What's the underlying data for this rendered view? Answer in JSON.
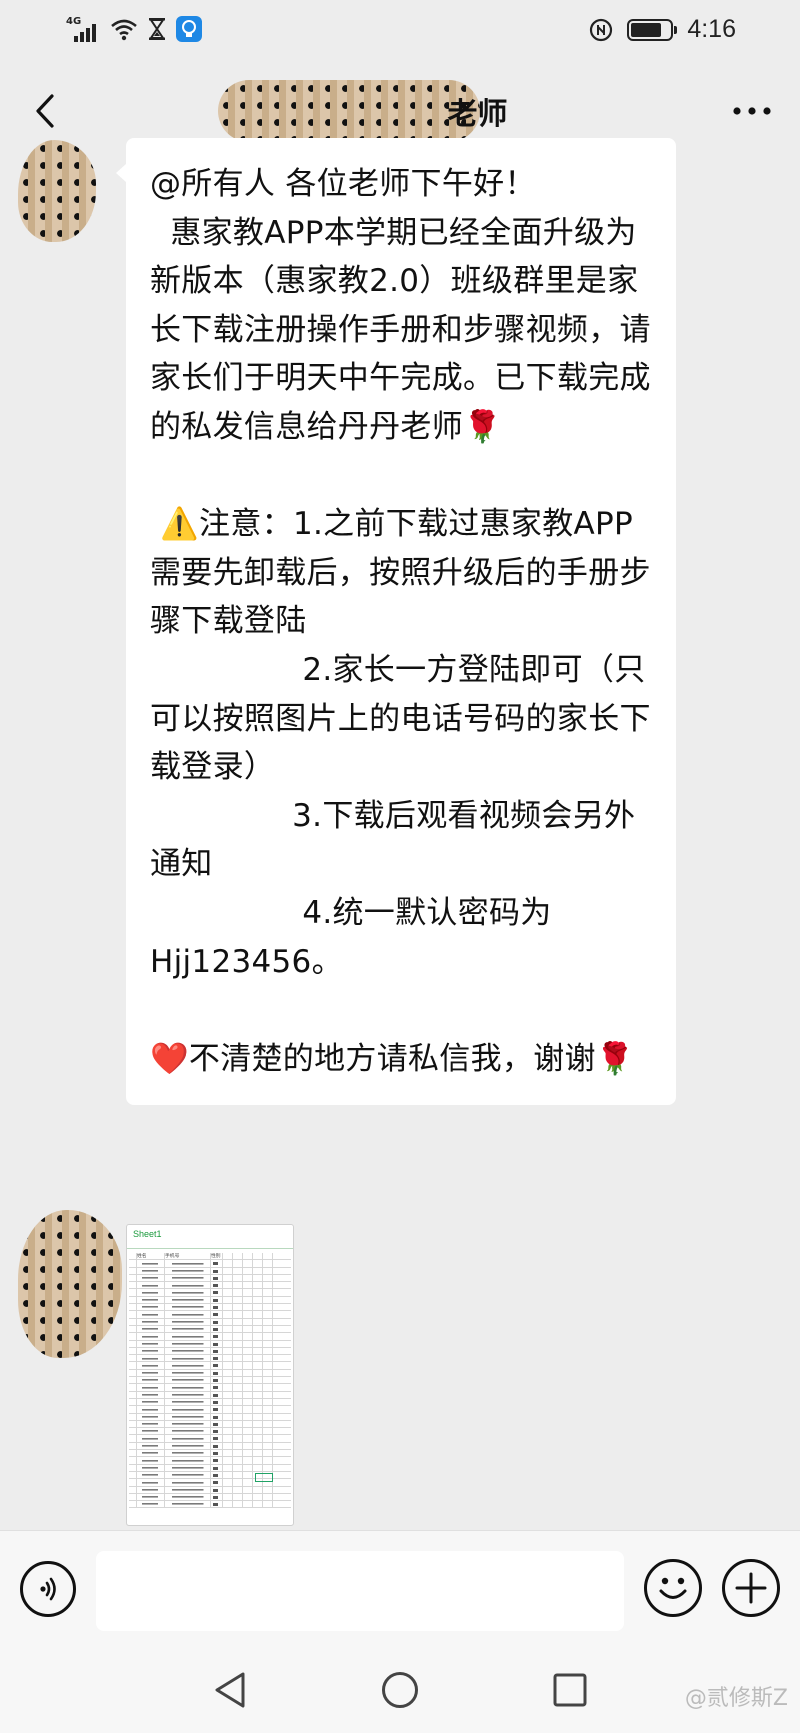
{
  "status_bar": {
    "network": "4G",
    "time": "4:16",
    "icons": [
      "signal-icon",
      "wifi-icon",
      "hourglass-icon",
      "notification-app-icon",
      "nfc-icon",
      "battery-icon"
    ]
  },
  "header": {
    "title": "老师",
    "back_icon": "chevron-left-icon",
    "more_icon": "more-dots-icon"
  },
  "messages": [
    {
      "type": "text",
      "text": "@所有人 各位老师下午好！\n  惠家教APP本学期已经全面升级为新版本（惠家教2.0）班级群里是家长下载注册操作手册和步骤视频，请家长们于明天中午完成。已下载完成的私发信息给丹丹老师🌹\n\n ⚠️注意：1.之前下载过惠家教APP需要先卸载后，按照升级后的手册步骤下载登陆\n               2.家长一方登陆即可（只可以按照图片上的电话号码的家长下载登录）\n              3.下载后观看视频会另外通知\n               4.统一默认密码为Hjj123456。\n\n❤️不清楚的地方请私信我，谢谢🌹"
    },
    {
      "type": "image",
      "sheet_tab": "Sheet1",
      "headers": [
        "",
        "姓名",
        "手机号",
        "性别"
      ]
    }
  ],
  "input_bar": {
    "placeholder": "",
    "voice_icon": "voice-icon",
    "emoji_icon": "emoji-icon",
    "plus_icon": "plus-icon"
  },
  "system_nav": {
    "back_icon": "triangle-back-icon",
    "home_icon": "circle-home-icon",
    "recents_icon": "square-recents-icon"
  },
  "watermark": "@贰修斯Z",
  "colors": {
    "background": "#ededed",
    "bubble": "#ffffff",
    "sheet_accent": "#1a9a3c"
  }
}
